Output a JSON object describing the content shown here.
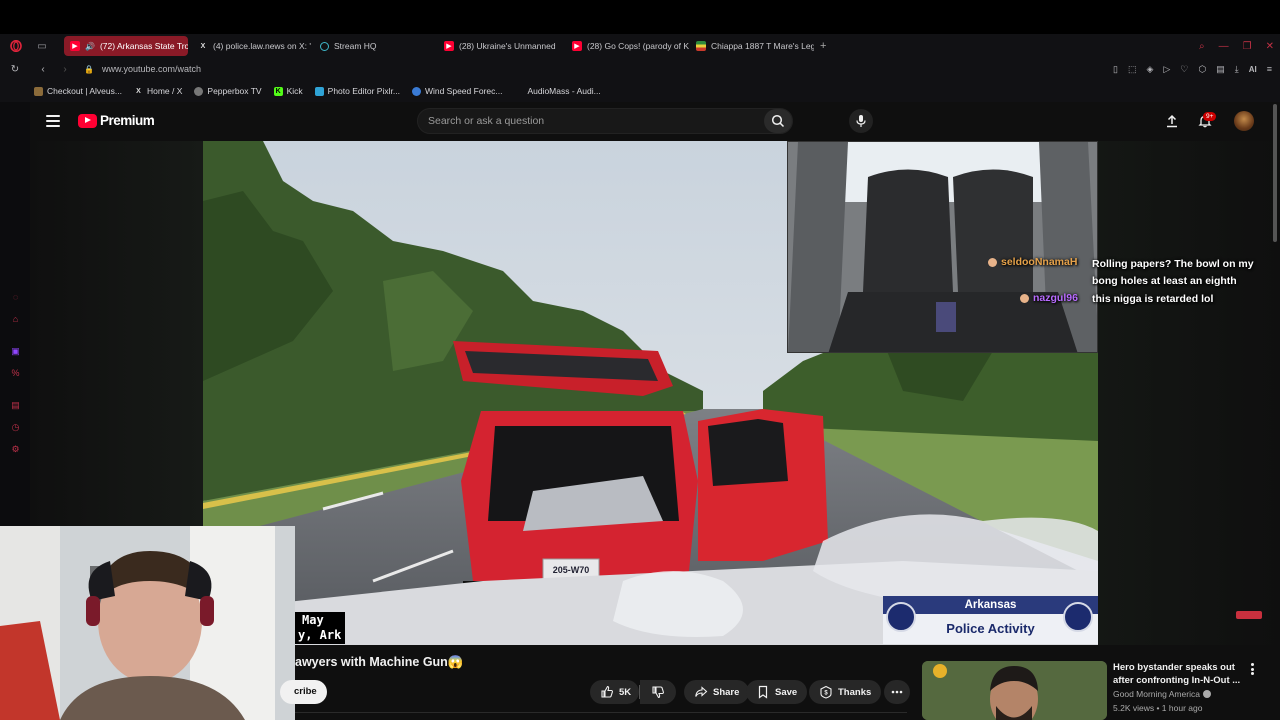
{
  "browser": {
    "tabs": [
      {
        "label": "(72) Arkansas State Tro",
        "icon": "youtube-icon",
        "active": true
      },
      {
        "label": "(4) police.law.news on X: '",
        "icon": "x-icon",
        "active": false
      },
      {
        "label": "Stream HQ",
        "icon": "stream-icon",
        "active": false
      },
      {
        "label": "(28) Ukraine's Unmanned",
        "icon": "youtube-icon",
        "active": false
      },
      {
        "label": "(28) Go Cops! (parody of K",
        "icon": "youtube-icon",
        "active": false
      },
      {
        "label": "Chiappa 1887 T Mare's Leg",
        "icon": "flag-icon",
        "active": false
      }
    ],
    "url": "www.youtube.com/watch",
    "addr_right_ai": "AI",
    "bookmarks": [
      {
        "label": "Checkout | Alveus...",
        "icon": "alveus-icon"
      },
      {
        "label": "Home / X",
        "icon": "x-icon"
      },
      {
        "label": "Pepperbox TV",
        "icon": "pepperbox-icon"
      },
      {
        "label": "Kick",
        "icon": "kick-icon"
      },
      {
        "label": "Photo Editor Pixlr...",
        "icon": "pixlr-icon"
      },
      {
        "label": "Wind Speed Forec...",
        "icon": "wind-icon"
      },
      {
        "label": "AudioMass - Audi...",
        "icon": "audiomass-icon"
      }
    ]
  },
  "youtube": {
    "brand": "Premium",
    "search_placeholder": "Search or ask a question",
    "notification_count": "9+",
    "video_title": "awyers with Machine Gun😱",
    "subscribe_label": "cribe",
    "actions": {
      "like_count": "5K",
      "share": "Share",
      "save": "Save",
      "thanks": "Thanks"
    }
  },
  "player": {
    "caption_lines": [
      "May",
      "y, Ark"
    ],
    "plate": "205-W70",
    "badge_top": "Arkansas",
    "badge_bottom": "Police Activity",
    "chat": [
      {
        "user": "seldooNnamaH",
        "message": "Rolling papers? The bowl on my bong holes at least an eighth",
        "color": "#e6a24a"
      },
      {
        "user": "nazgul96",
        "message": "this nigga is retarded lol",
        "color": "#b86bff"
      }
    ]
  },
  "recommendation": {
    "title": "Hero bystander speaks out after confronting In-N-Out ...",
    "channel": "Good Morning America",
    "meta": "5.2K views • 1 hour ago"
  },
  "colors": {
    "accent": "#ff0033",
    "active_tab": "#8a1a27",
    "browser_accent": "#e0243b"
  }
}
